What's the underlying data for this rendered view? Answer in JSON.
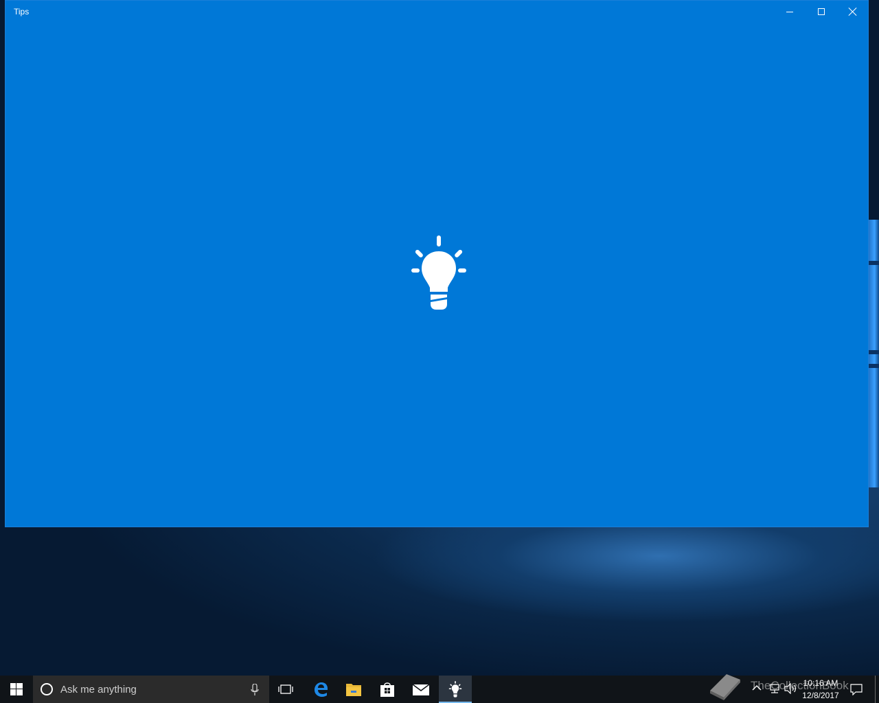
{
  "window": {
    "title": "Tips",
    "background": "#0078d7",
    "controls": {
      "minimize": "minimize-icon",
      "maximize": "maximize-icon",
      "close": "close-icon"
    },
    "splash_icon": "lightbulb-icon"
  },
  "taskbar": {
    "search_placeholder": "Ask me anything",
    "pinned": [
      {
        "name": "task-view",
        "icon": "task-view-icon"
      },
      {
        "name": "edge",
        "icon": "edge-icon",
        "color": "#1e88e5"
      },
      {
        "name": "file-explorer",
        "icon": "folder-icon",
        "color": "#f4c542"
      },
      {
        "name": "store",
        "icon": "store-icon"
      },
      {
        "name": "mail",
        "icon": "mail-icon"
      },
      {
        "name": "tips",
        "icon": "lightbulb-icon",
        "active": true
      }
    ],
    "tray": {
      "time": "10:16 AM",
      "date": "12/8/2017",
      "watermark": "TheCollectionBook"
    }
  }
}
